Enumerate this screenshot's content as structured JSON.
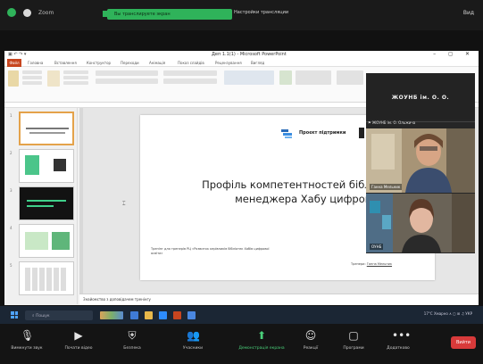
{
  "zoom_top": {
    "meeting_label": "Zoom",
    "share_banner": "Вы транслируете экран",
    "share_settings": "Настройки трансляции",
    "view_label": "Вид"
  },
  "ppt": {
    "window_title": "Деп 1.1(1) - Microsoft PowerPoint",
    "tab_file": "Файл",
    "tabs": [
      "Головна",
      "Вставлення",
      "Конструктор",
      "Переходи",
      "Анімація",
      "Показ слайдів",
      "Рецензування",
      "Вигляд"
    ],
    "notes_text": "Знайомство з доповідачем тренінгу"
  },
  "slide": {
    "project_label": "Проєкт підтримки",
    "title_line1": "Профіль компетентностей бібліотекаря",
    "title_line2": "менеджера Хабу цифрової освіти",
    "small_text": "Тренінг для тренерів РЦ «Розвиток керівників бібліотек Хабів цифрової освіти»",
    "right_text_prefix": "Тренери:",
    "right_text_name": "Ганна Мельник"
  },
  "participants": {
    "main_name": "ЖОУНБ ім. О. О.",
    "pin_label": "ЖОУНБ ім. О. Ольжича",
    "tile1_label": "Ганна Мельник",
    "tile2_label": "ОУНБ"
  },
  "taskbar": {
    "search_placeholder": "Пошук",
    "tray_text": "17°C  Хмарно   ∧  ◻  ⊞  ♫  УКР"
  },
  "toolbar": {
    "buttons": [
      {
        "label": "Вимкнути звук",
        "icon": "mic-icon"
      },
      {
        "label": "Почати відео",
        "icon": "video-icon"
      },
      {
        "label": "Безпека",
        "icon": "shield-icon"
      },
      {
        "label": "Учасники",
        "icon": "participants-icon"
      },
      {
        "label": "Демонстрація екрана",
        "icon": "share-screen-icon"
      },
      {
        "label": "Реакції",
        "icon": "reactions-icon"
      },
      {
        "label": "Програми",
        "icon": "apps-icon"
      },
      {
        "label": "Додатково",
        "icon": "more-icon"
      }
    ],
    "end_label": "Вийти"
  },
  "colors": {
    "zoom_green": "#2fb35a",
    "ppt_accent": "#c7451f",
    "end_red": "#d83a3a",
    "taskbar": "#1b2634"
  }
}
